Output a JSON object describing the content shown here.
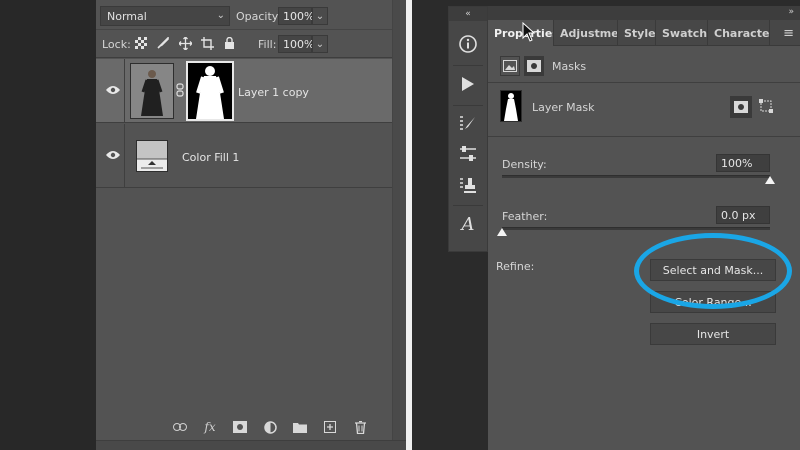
{
  "layers_panel": {
    "blend_mode": "Normal",
    "opacity_label": "Opacity:",
    "opacity_value": "100%",
    "lock_label": "Lock:",
    "fill_label": "Fill:",
    "fill_value": "100%",
    "layers": [
      {
        "name": "Layer 1 copy",
        "selected": true
      },
      {
        "name": "Color Fill 1",
        "selected": false
      }
    ],
    "footer_icons": [
      "link-icon",
      "fx-icon",
      "mask-icon",
      "adjustment-icon",
      "folder-icon",
      "new-layer-icon",
      "trash-icon"
    ],
    "fx_label": "fx"
  },
  "tool_strip": {
    "collapse_label": "«",
    "tools": [
      "info-icon",
      "play-icon",
      "brush-settings-icon",
      "adjust-sliders-icon",
      "clone-source-icon",
      "character-icon"
    ],
    "character_glyph": "A"
  },
  "properties_panel": {
    "collapse_label": "»",
    "tabs": [
      "Properties",
      "Adjustments",
      "Styles",
      "Swatches",
      "Character"
    ],
    "menu_label": "≡",
    "masks_label": "Masks",
    "layer_mask_label": "Layer Mask",
    "density_label": "Density:",
    "density_value": "100%",
    "density_level": 1.0,
    "feather_label": "Feather:",
    "feather_value": "0.0 px",
    "feather_level": 0.0,
    "refine_label": "Refine:",
    "buttons": {
      "select_and_mask": "Select and Mask...",
      "color_range": "Color Range...",
      "invert": "Invert"
    },
    "highlight_color": "#1aa6e6"
  }
}
